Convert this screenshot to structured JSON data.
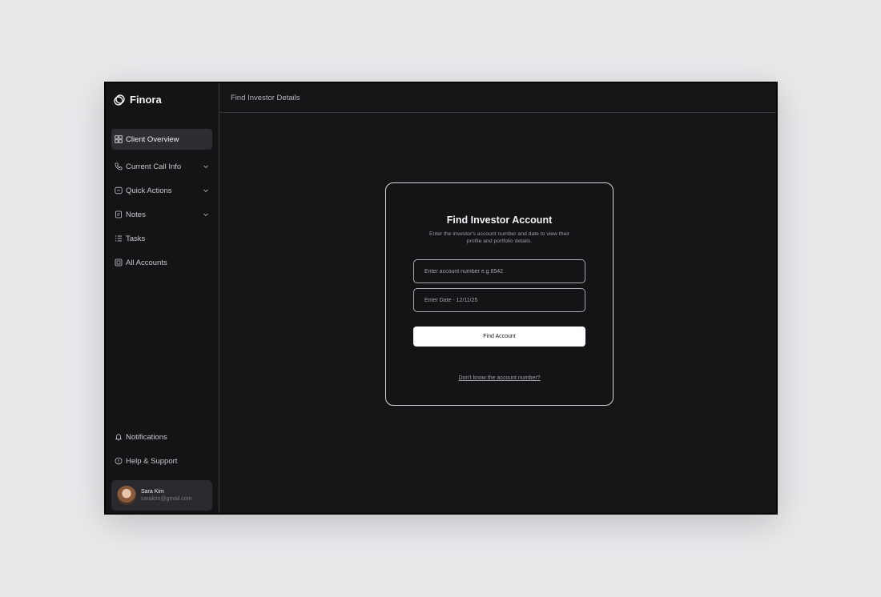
{
  "app": {
    "name": "Finora"
  },
  "sidebar": {
    "items": [
      {
        "label": "Client Overview",
        "icon": "dashboard-icon",
        "active": true,
        "expandable": false
      },
      {
        "label": "Current Call Info",
        "icon": "phone-icon",
        "active": false,
        "expandable": true
      },
      {
        "label": "Quick Actions",
        "icon": "message-icon",
        "active": false,
        "expandable": true
      },
      {
        "label": "Notes",
        "icon": "note-icon",
        "active": false,
        "expandable": true
      },
      {
        "label": "Tasks",
        "icon": "list-icon",
        "active": false,
        "expandable": false
      },
      {
        "label": "All Accounts",
        "icon": "accounts-icon",
        "active": false,
        "expandable": false
      }
    ],
    "bottom_items": [
      {
        "label": "Notifications",
        "icon": "bell-icon"
      },
      {
        "label": "Help & Support",
        "icon": "info-icon"
      }
    ],
    "user": {
      "name": "Sara Kim",
      "email": "sarakim@gmail.com"
    }
  },
  "header": {
    "title": "Find Investor Details"
  },
  "card": {
    "title": "Find Investor Account",
    "description": "Enter the investor's account number and date to view their profile and portfolio details.",
    "account_placeholder": "Enter account number e.g 6542",
    "date_placeholder": "Enter Date - 12/11/25",
    "button_label": "Find Account",
    "help_link": "Don't know the account number?"
  },
  "colors": {
    "background": "#e9e8eb",
    "window": "#151417",
    "active_item": "#2e2d32",
    "button": "#ffffff"
  }
}
